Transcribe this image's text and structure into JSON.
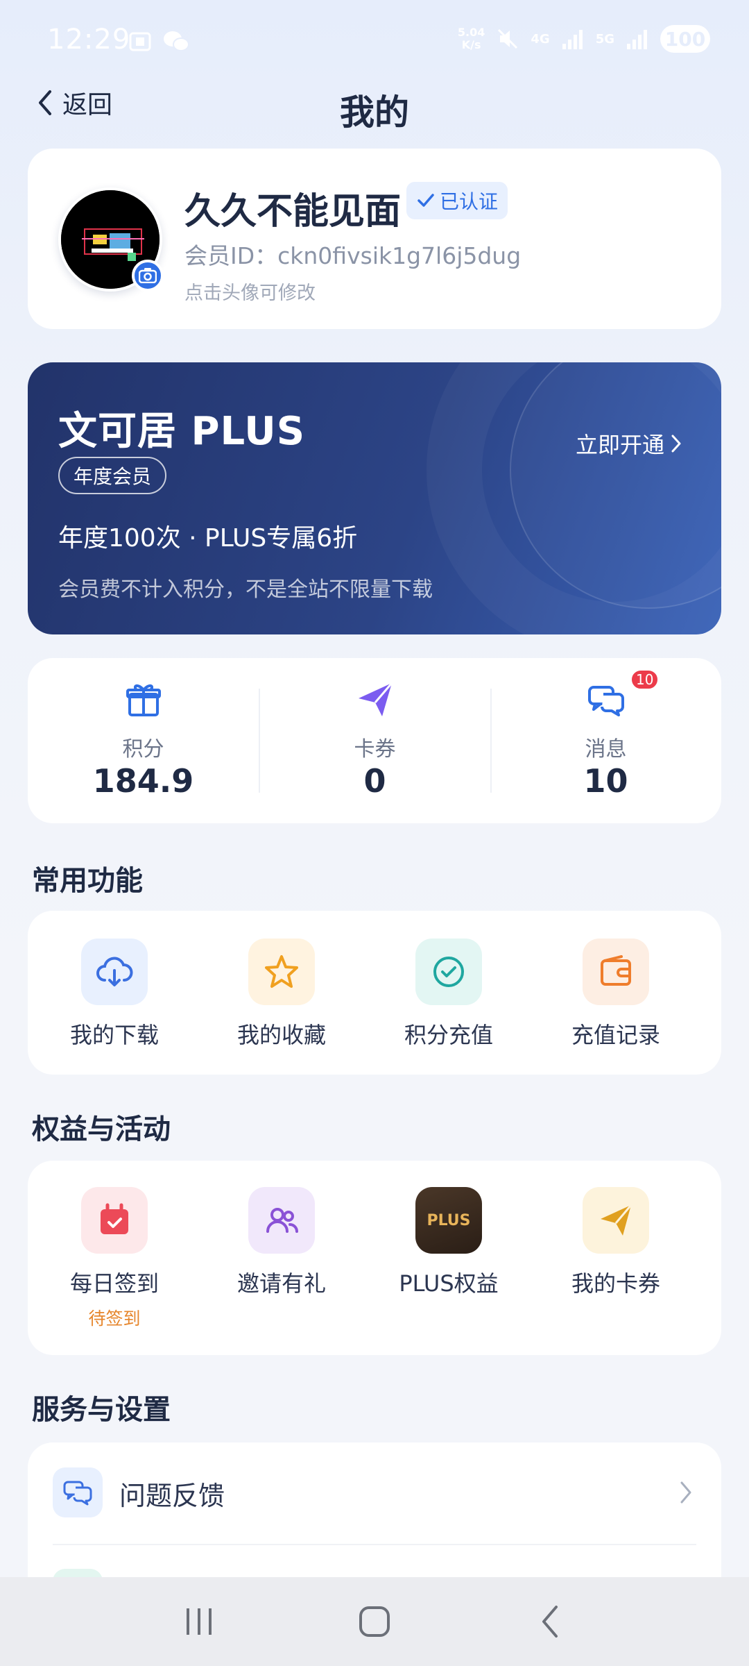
{
  "status_bar": {
    "time": "12:29",
    "speed_value": "5.04",
    "speed_unit": "K/s",
    "net1": "4G",
    "net2": "5G",
    "battery": "100"
  },
  "header": {
    "back_label": "返回",
    "title": "我的"
  },
  "profile": {
    "name": "久久不能见面",
    "verified_label": "已认证",
    "member_id": "会员ID：ckn0fivsik1g7l6j5dug",
    "avatar_hint": "点击头像可修改"
  },
  "plus": {
    "title": "文可居 PLUS",
    "tag": "年度会员",
    "open_label": "立即开通",
    "description": "年度100次 · PLUS专属6折",
    "note": "会员费不计入积分，不是全站不限量下载"
  },
  "stats": [
    {
      "label": "积分",
      "value": "184.9",
      "icon": "gift-icon"
    },
    {
      "label": "卡券",
      "value": "0",
      "icon": "paper-plane-icon"
    },
    {
      "label": "消息",
      "value": "10",
      "icon": "chat-icon",
      "badge": "10"
    }
  ],
  "common": {
    "title": "常用功能",
    "items": [
      {
        "label": "我的下载",
        "icon": "cloud-download-icon",
        "color": "#3b6fe0"
      },
      {
        "label": "我的收藏",
        "icon": "star-icon",
        "color": "#f0a020"
      },
      {
        "label": "积分充值",
        "icon": "check-circle-icon",
        "color": "#1fa7a0"
      },
      {
        "label": "充值记录",
        "icon": "wallet-icon",
        "color": "#ef7d2c"
      }
    ]
  },
  "benefits": {
    "title": "权益与活动",
    "items": [
      {
        "label": "每日签到",
        "sub": "待签到",
        "icon": "calendar-check-icon",
        "color": "#ec4a58"
      },
      {
        "label": "邀请有礼",
        "icon": "users-icon",
        "color": "#8a52d6"
      },
      {
        "label": "PLUS权益",
        "icon": "plus-badge-icon",
        "badge_text": "PLUS",
        "color": "#e8b45a"
      },
      {
        "label": "我的卡券",
        "icon": "paper-plane-icon",
        "color": "#e0a020"
      }
    ]
  },
  "services": {
    "title": "服务与设置",
    "items": [
      {
        "label": "问题反馈",
        "icon": "chat-icon"
      }
    ]
  }
}
